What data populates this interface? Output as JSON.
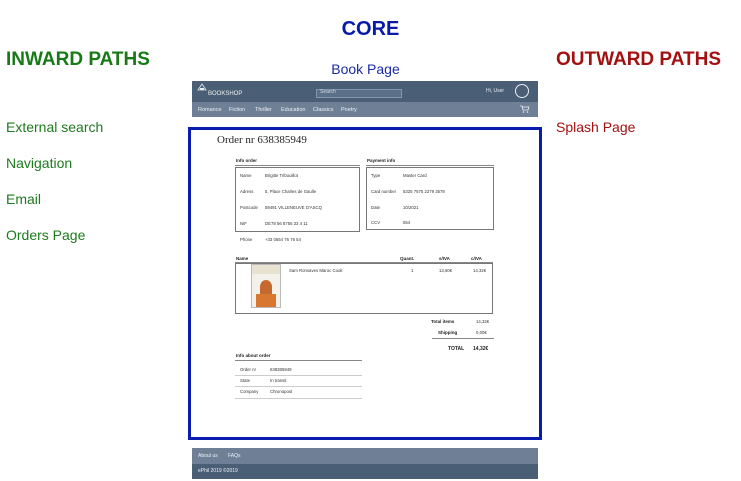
{
  "core": {
    "title": "CORE",
    "page_label": "Book Page"
  },
  "inward": {
    "title": "INWARD PATHS",
    "items": [
      "External search",
      "Navigation",
      "Email",
      "Orders Page"
    ]
  },
  "outward": {
    "title": "OUTWARD PATHS",
    "items": [
      "Splash Page"
    ]
  },
  "mockup": {
    "logo": "BOOKSHOP",
    "search_placeholder": "Search",
    "user": "Hi, User",
    "nav": [
      "Romance",
      "Fiction",
      "Thriller",
      "Education",
      "Classics",
      "Poetry"
    ],
    "order": {
      "title": "Order nr 638385949",
      "info_order": {
        "heading": "Info order",
        "rows": [
          {
            "label": "Name",
            "value": "Brigitte Tribouillot"
          },
          {
            "label": "Adress",
            "value": "5, Place Charles de Gaulle"
          },
          {
            "label": "Postcode",
            "value": "59491 VILLENEUVE D'ASCQ"
          },
          {
            "label": "NIF",
            "value": "DE78 56 8755 33 4 11"
          },
          {
            "label": "Phone",
            "value": "+33 0654 76 76 54"
          }
        ]
      },
      "payment": {
        "heading": "Payment info",
        "rows": [
          {
            "label": "Type",
            "value": "Master Card"
          },
          {
            "label": "Card number",
            "value": "5325 7575 2279 3578"
          },
          {
            "label": "Date",
            "value": "10/2021"
          },
          {
            "label": "CCV",
            "value": "554"
          }
        ]
      },
      "items": {
        "headers": [
          "Name",
          "Quant.",
          "s/IVA",
          "c/IVA"
        ],
        "rows": [
          {
            "name": "Sam Ronsaves Maroc Cook",
            "quantity": "1",
            "without_vat": "13,60€",
            "with_vat": "14,32€"
          }
        ]
      },
      "totals": [
        {
          "label": "Total items",
          "value": "14,32€"
        },
        {
          "label": "Shipping",
          "value": "0,00€"
        },
        {
          "label": "TOTAL",
          "value": "14,32€"
        }
      ],
      "info_about": {
        "heading": "Info about order",
        "rows": [
          {
            "label": "Order nr",
            "value": "638385949"
          },
          {
            "label": "State",
            "value": "In transit"
          },
          {
            "label": "Company",
            "value": "Chronopost"
          }
        ]
      }
    },
    "footer": {
      "links": [
        "About us",
        "FAQs"
      ],
      "copyright": "ePhil 2019 ©2019"
    }
  }
}
